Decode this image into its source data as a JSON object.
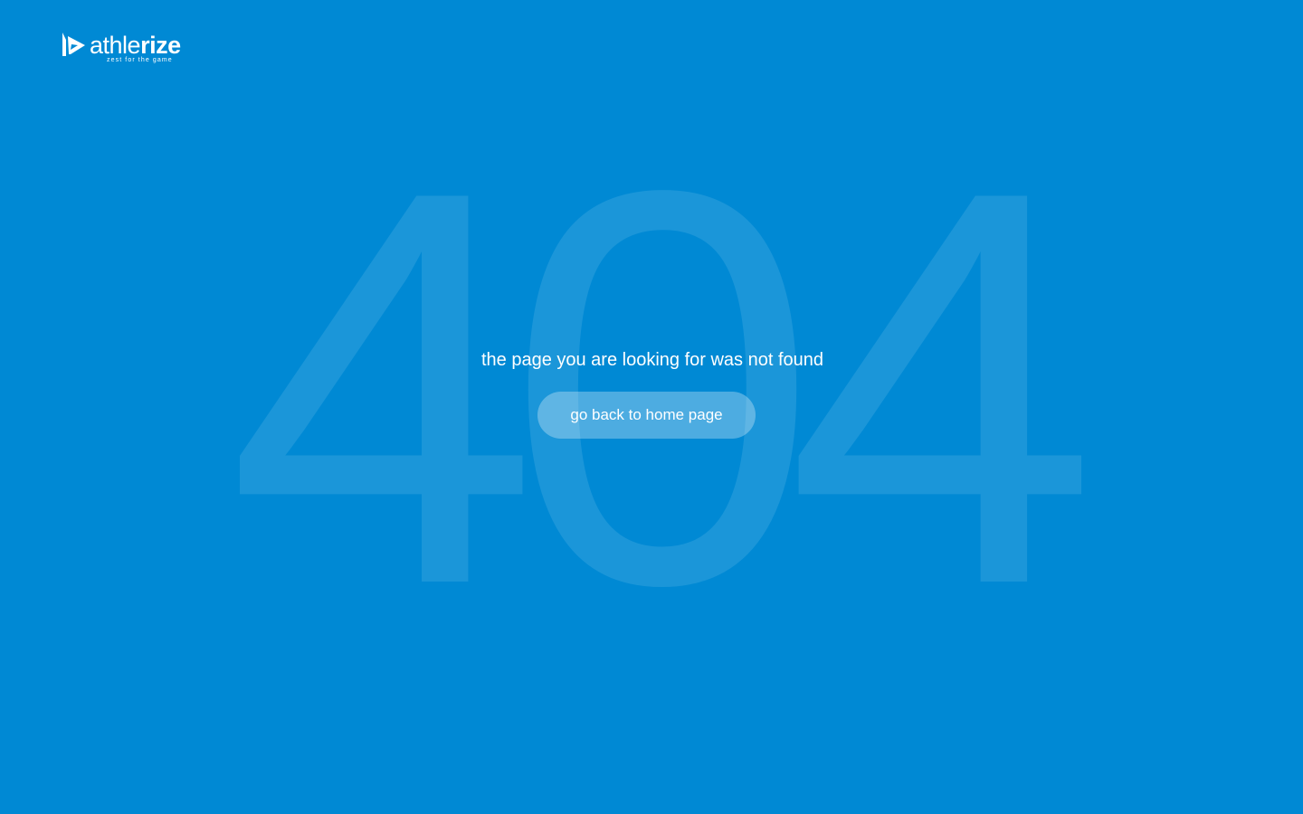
{
  "brand": {
    "wordmark_light": "athle",
    "wordmark_bold": "rize",
    "tagline": "zest for the game"
  },
  "error": {
    "code": "404",
    "message": "the page you are looking for was not found"
  },
  "actions": {
    "home_label": "go back to home page"
  },
  "colors": {
    "background": "#0089d4",
    "code_fill": "#1b96d9",
    "text": "#ffffff"
  },
  "icons": {
    "logo": "athlerize-logo-mark-icon"
  }
}
